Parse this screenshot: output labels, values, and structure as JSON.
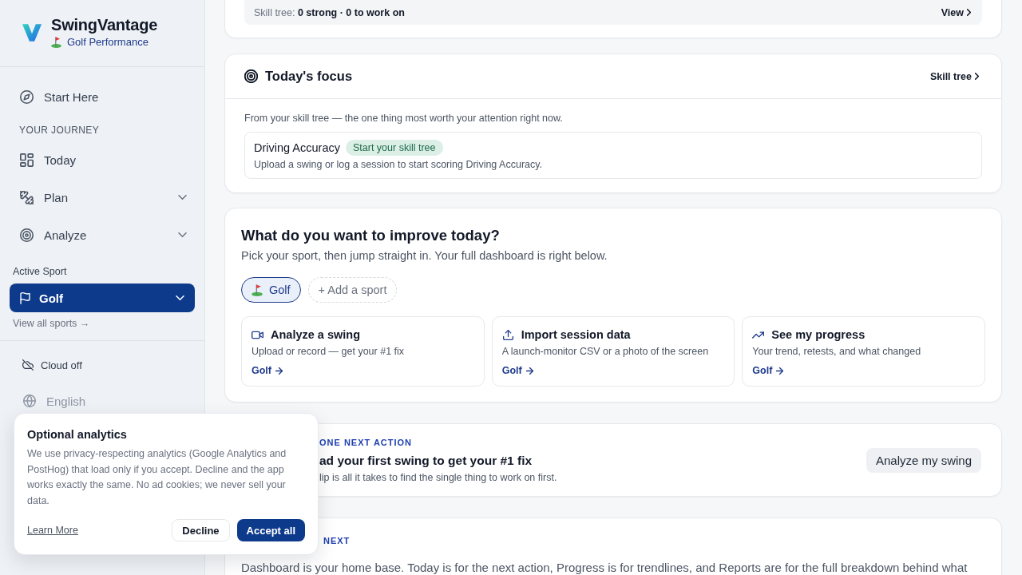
{
  "sidebar": {
    "brand": {
      "name": "SwingVantage",
      "tagline": "Golf Performance"
    },
    "start": {
      "label": "Start Here"
    },
    "journey": {
      "heading": "YOUR JOURNEY",
      "items": [
        {
          "label": "Today"
        },
        {
          "label": "Plan",
          "expanded": false
        },
        {
          "label": "Analyze",
          "expanded": false
        }
      ]
    },
    "active_sport": {
      "label": "Active Sport",
      "sport": "Golf",
      "expanded": false,
      "link": "View all sports →"
    },
    "settings": [
      {
        "label": "Cloud off",
        "disabled": false
      },
      {
        "label": "English",
        "disabled": true
      }
    ]
  },
  "skill_summary": {
    "label": "Skill tree:",
    "value": "0 strong · 0 to work on",
    "link": "View"
  },
  "focus": {
    "title": "Today's focus",
    "link": "Skill tree",
    "description": "From your skill tree — the one thing most worth your attention right now.",
    "item": {
      "name": "Driving Accuracy",
      "badge": "Start your skill tree",
      "text": "Upload a swing or log a session to start scoring Driving Accuracy."
    }
  },
  "improve": {
    "title": "What do you want to improve today?",
    "subtitle": "Pick your sport, then jump straight in. Your full dashboard is right below.",
    "sports": [
      {
        "label": "Golf",
        "selected": true
      }
    ],
    "add_sport": "+ Add a sport",
    "actions": [
      {
        "title": "Analyze a swing",
        "text": "Upload or record — get your #1 fix",
        "link": "Golf"
      },
      {
        "title": "Import session data",
        "text": "A launch-monitor CSV or a photo of the screen",
        "link": "Golf"
      },
      {
        "title": "See my progress",
        "text": "Your trend, retests, and what changed",
        "link": "Golf"
      }
    ]
  },
  "next_action": {
    "eyebrow": "ONE NEXT ACTION",
    "title": "ad your first swing to get your #1 fix",
    "text": "lip is all it takes to find the single thing to work on first.",
    "button": "Analyze my swing"
  },
  "whats_next": {
    "eyebrow": "NEXT",
    "text": "Dashboard is your home base. Today is for the next action, Progress is for trendlines, and Reports are for the full breakdown behind what"
  },
  "consent": {
    "title": "Optional analytics",
    "text": "We use privacy-respecting analytics (Google Analytics and PostHog) that load only if you accept. Decline and the app works exactly the same. No ad cookies; we never sell your data.",
    "link": "Learn More",
    "buttons": [
      {
        "label": "Decline",
        "kind": "secondary"
      },
      {
        "label": "Accept all",
        "kind": "primary"
      }
    ]
  }
}
